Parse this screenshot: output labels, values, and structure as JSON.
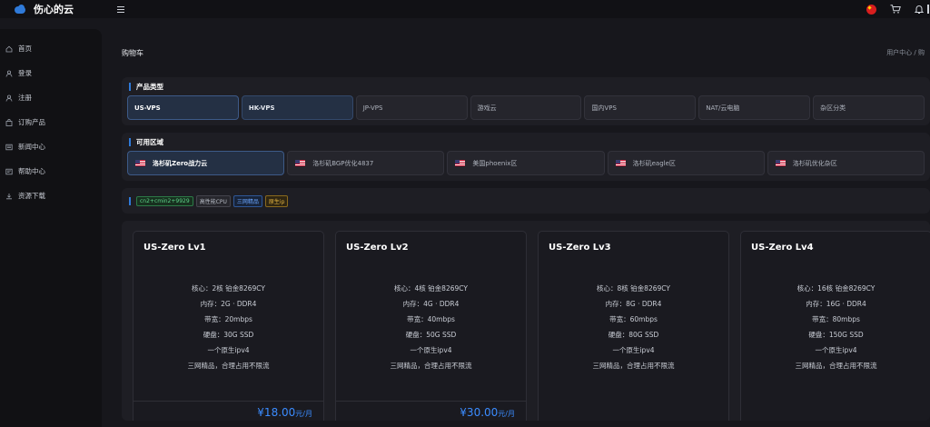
{
  "app": {
    "logo_text": "伤心的云"
  },
  "sidebar": {
    "items": [
      {
        "label": "首页",
        "icon": "home-icon"
      },
      {
        "label": "登录",
        "icon": "user-icon"
      },
      {
        "label": "注册",
        "icon": "user-icon"
      },
      {
        "label": "订购产品",
        "icon": "shopping-bag-icon"
      },
      {
        "label": "新闻中心",
        "icon": "news-icon"
      },
      {
        "label": "帮助中心",
        "icon": "help-icon"
      },
      {
        "label": "资源下载",
        "icon": "download-icon"
      }
    ]
  },
  "page": {
    "title": "购物车",
    "breadcrumb": "用户中心 / 购"
  },
  "product_types": {
    "title": "产品类型",
    "items": [
      "US-VPS",
      "HK-VPS",
      "JP-VPS",
      "游戏云",
      "国内VPS",
      "NAT/云电脑",
      "杂区分类"
    ]
  },
  "regions": {
    "title": "可用区域",
    "items": [
      "洛杉矶Zero战力云",
      "洛杉矶BGP优化4837",
      "美国phoenix区",
      "洛杉矶eagle区",
      "洛杉矶优化杂区"
    ]
  },
  "tags": [
    {
      "label": "cn2+cmin2+9929",
      "color": "#5fd38a"
    },
    {
      "label": "高性能CPU",
      "color": "#b7bcc5"
    },
    {
      "label": "三网精品",
      "color": "#6aa6ff"
    },
    {
      "label": "原生ip",
      "color": "#e3b341"
    }
  ],
  "products": [
    {
      "name": "US-Zero Lv1",
      "specs": [
        "核心：2核 铂金8269CY",
        "内存：2G · DDR4",
        "带宽：20mbps",
        "硬盘：30G SSD",
        "一个原生ipv4",
        "三网精品，合理占用不限流"
      ],
      "price": "¥18.00",
      "price_unit": "元/月"
    },
    {
      "name": "US-Zero Lv2",
      "specs": [
        "核心：4核 铂金8269CY",
        "内存：4G · DDR4",
        "带宽：40mbps",
        "硬盘：50G SSD",
        "一个原生ipv4",
        "三网精品，合理占用不限流"
      ],
      "price": "¥30.00",
      "price_unit": "元/月"
    },
    {
      "name": "US-Zero Lv3",
      "specs": [
        "核心：8核 铂金8269CY",
        "内存：8G · DDR4",
        "带宽：60mbps",
        "硬盘：80G SSD",
        "一个原生ipv4",
        "三网精品，合理占用不限流"
      ],
      "price": "",
      "price_unit": ""
    },
    {
      "name": "US-Zero Lv4",
      "specs": [
        "核心：16核 铂金8269CY",
        "内存：16G · DDR4",
        "带宽：80mbps",
        "硬盘：150G SSD",
        "一个原生ipv4",
        "三网精品，合理占用不限流"
      ],
      "price": "",
      "price_unit": ""
    }
  ],
  "colors": {
    "accent": "#2f7ad9",
    "price": "#3b8cff"
  }
}
